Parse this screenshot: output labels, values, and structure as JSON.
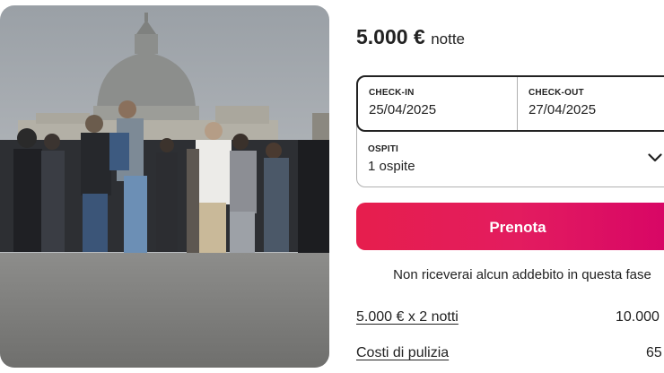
{
  "photo": {
    "alt": "Crowd of tourists in front of St. Peter's Basilica"
  },
  "price": {
    "amount": "5.000 €",
    "unit": "notte"
  },
  "checkin": {
    "label": "CHECK-IN",
    "value": "25/04/2025"
  },
  "checkout": {
    "label": "CHECK-OUT",
    "value": "27/04/2025"
  },
  "guests": {
    "label": "OSPITI",
    "value": "1 ospite"
  },
  "book_button": "Prenota",
  "note": "Non riceverai alcun addebito in questa fase",
  "line_items": [
    {
      "label": "5.000 € x 2 notti",
      "amount": "10.000"
    },
    {
      "label": "Costi di pulizia",
      "amount": "65"
    }
  ],
  "colors": {
    "accent_start": "#e61e4d",
    "accent_end": "#d70466",
    "text": "#222222"
  }
}
